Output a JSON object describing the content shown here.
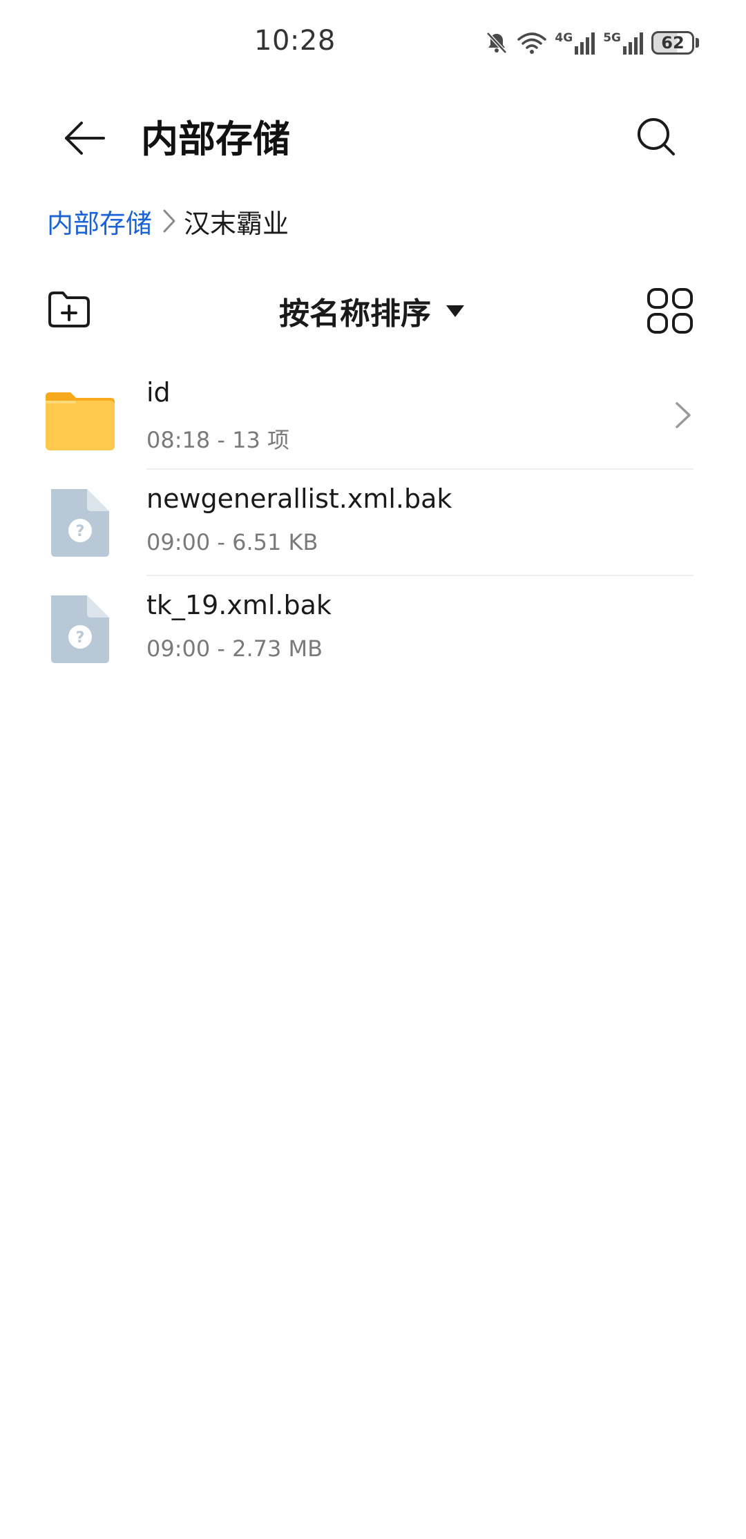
{
  "status_bar": {
    "time": "10:28",
    "network_1": "4G",
    "network_2": "5G",
    "battery": "62",
    "icons": [
      "bell-muted-icon",
      "wifi-icon",
      "signal-4g-icon",
      "signal-5g-icon",
      "battery-icon"
    ]
  },
  "header": {
    "title": "内部存储",
    "back_icon": "arrow-left-icon",
    "search_icon": "search-icon"
  },
  "breadcrumb": {
    "root": "内部存储",
    "current": "汉末霸业"
  },
  "toolbar": {
    "sort_label": "按名称排序",
    "new_folder_icon": "folder-plus-icon",
    "view_icon": "grid-view-icon"
  },
  "files": [
    {
      "name": "id",
      "meta": "08:18 - 13 项",
      "type": "folder"
    },
    {
      "name": "newgenerallist.xml.bak",
      "meta": "09:00 - 6.51 KB",
      "type": "unknown-file"
    },
    {
      "name": "tk_19.xml.bak",
      "meta": "09:00 - 2.73 MB",
      "type": "unknown-file"
    }
  ],
  "colors": {
    "accent": "#1a63d6",
    "folder": "#ffc94d",
    "folder_tab": "#f7a91e",
    "file_icon": "#b9c8d6"
  }
}
